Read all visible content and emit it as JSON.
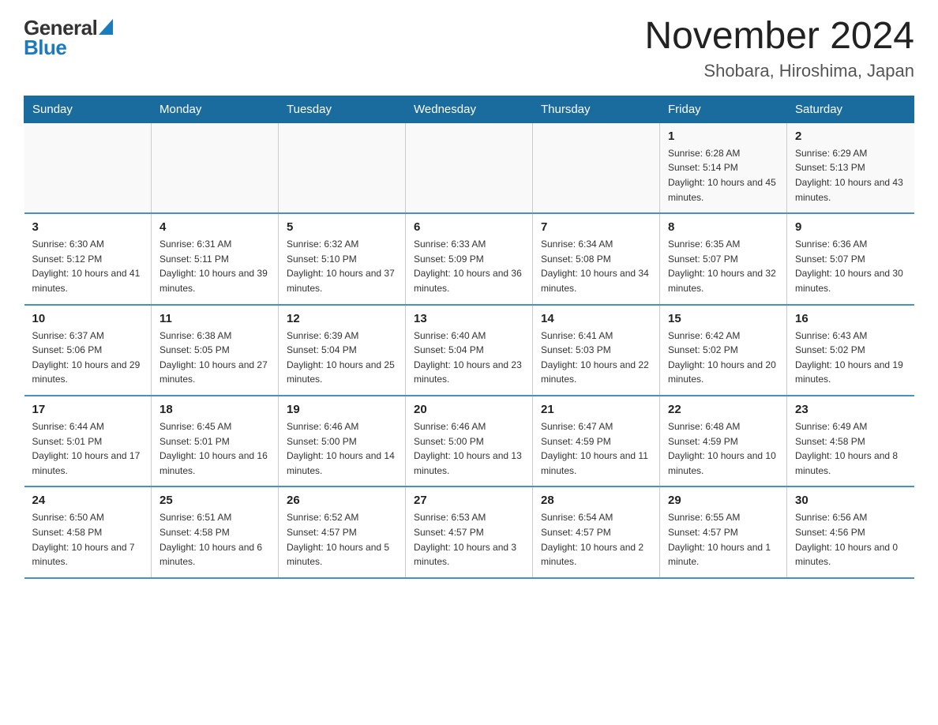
{
  "header": {
    "logo_general": "General",
    "logo_blue": "Blue",
    "title": "November 2024",
    "subtitle": "Shobara, Hiroshima, Japan"
  },
  "weekdays": [
    "Sunday",
    "Monday",
    "Tuesday",
    "Wednesday",
    "Thursday",
    "Friday",
    "Saturday"
  ],
  "weeks": [
    [
      {
        "day": "",
        "info": ""
      },
      {
        "day": "",
        "info": ""
      },
      {
        "day": "",
        "info": ""
      },
      {
        "day": "",
        "info": ""
      },
      {
        "day": "",
        "info": ""
      },
      {
        "day": "1",
        "info": "Sunrise: 6:28 AM\nSunset: 5:14 PM\nDaylight: 10 hours and 45 minutes."
      },
      {
        "day": "2",
        "info": "Sunrise: 6:29 AM\nSunset: 5:13 PM\nDaylight: 10 hours and 43 minutes."
      }
    ],
    [
      {
        "day": "3",
        "info": "Sunrise: 6:30 AM\nSunset: 5:12 PM\nDaylight: 10 hours and 41 minutes."
      },
      {
        "day": "4",
        "info": "Sunrise: 6:31 AM\nSunset: 5:11 PM\nDaylight: 10 hours and 39 minutes."
      },
      {
        "day": "5",
        "info": "Sunrise: 6:32 AM\nSunset: 5:10 PM\nDaylight: 10 hours and 37 minutes."
      },
      {
        "day": "6",
        "info": "Sunrise: 6:33 AM\nSunset: 5:09 PM\nDaylight: 10 hours and 36 minutes."
      },
      {
        "day": "7",
        "info": "Sunrise: 6:34 AM\nSunset: 5:08 PM\nDaylight: 10 hours and 34 minutes."
      },
      {
        "day": "8",
        "info": "Sunrise: 6:35 AM\nSunset: 5:07 PM\nDaylight: 10 hours and 32 minutes."
      },
      {
        "day": "9",
        "info": "Sunrise: 6:36 AM\nSunset: 5:07 PM\nDaylight: 10 hours and 30 minutes."
      }
    ],
    [
      {
        "day": "10",
        "info": "Sunrise: 6:37 AM\nSunset: 5:06 PM\nDaylight: 10 hours and 29 minutes."
      },
      {
        "day": "11",
        "info": "Sunrise: 6:38 AM\nSunset: 5:05 PM\nDaylight: 10 hours and 27 minutes."
      },
      {
        "day": "12",
        "info": "Sunrise: 6:39 AM\nSunset: 5:04 PM\nDaylight: 10 hours and 25 minutes."
      },
      {
        "day": "13",
        "info": "Sunrise: 6:40 AM\nSunset: 5:04 PM\nDaylight: 10 hours and 23 minutes."
      },
      {
        "day": "14",
        "info": "Sunrise: 6:41 AM\nSunset: 5:03 PM\nDaylight: 10 hours and 22 minutes."
      },
      {
        "day": "15",
        "info": "Sunrise: 6:42 AM\nSunset: 5:02 PM\nDaylight: 10 hours and 20 minutes."
      },
      {
        "day": "16",
        "info": "Sunrise: 6:43 AM\nSunset: 5:02 PM\nDaylight: 10 hours and 19 minutes."
      }
    ],
    [
      {
        "day": "17",
        "info": "Sunrise: 6:44 AM\nSunset: 5:01 PM\nDaylight: 10 hours and 17 minutes."
      },
      {
        "day": "18",
        "info": "Sunrise: 6:45 AM\nSunset: 5:01 PM\nDaylight: 10 hours and 16 minutes."
      },
      {
        "day": "19",
        "info": "Sunrise: 6:46 AM\nSunset: 5:00 PM\nDaylight: 10 hours and 14 minutes."
      },
      {
        "day": "20",
        "info": "Sunrise: 6:46 AM\nSunset: 5:00 PM\nDaylight: 10 hours and 13 minutes."
      },
      {
        "day": "21",
        "info": "Sunrise: 6:47 AM\nSunset: 4:59 PM\nDaylight: 10 hours and 11 minutes."
      },
      {
        "day": "22",
        "info": "Sunrise: 6:48 AM\nSunset: 4:59 PM\nDaylight: 10 hours and 10 minutes."
      },
      {
        "day": "23",
        "info": "Sunrise: 6:49 AM\nSunset: 4:58 PM\nDaylight: 10 hours and 8 minutes."
      }
    ],
    [
      {
        "day": "24",
        "info": "Sunrise: 6:50 AM\nSunset: 4:58 PM\nDaylight: 10 hours and 7 minutes."
      },
      {
        "day": "25",
        "info": "Sunrise: 6:51 AM\nSunset: 4:58 PM\nDaylight: 10 hours and 6 minutes."
      },
      {
        "day": "26",
        "info": "Sunrise: 6:52 AM\nSunset: 4:57 PM\nDaylight: 10 hours and 5 minutes."
      },
      {
        "day": "27",
        "info": "Sunrise: 6:53 AM\nSunset: 4:57 PM\nDaylight: 10 hours and 3 minutes."
      },
      {
        "day": "28",
        "info": "Sunrise: 6:54 AM\nSunset: 4:57 PM\nDaylight: 10 hours and 2 minutes."
      },
      {
        "day": "29",
        "info": "Sunrise: 6:55 AM\nSunset: 4:57 PM\nDaylight: 10 hours and 1 minute."
      },
      {
        "day": "30",
        "info": "Sunrise: 6:56 AM\nSunset: 4:56 PM\nDaylight: 10 hours and 0 minutes."
      }
    ]
  ]
}
